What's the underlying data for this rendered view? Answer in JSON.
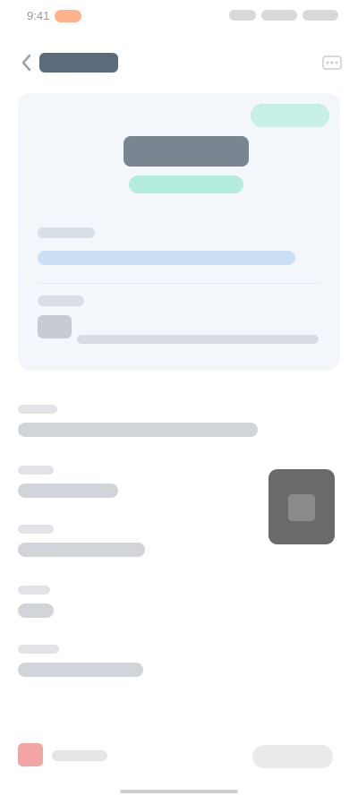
{
  "status_bar": {
    "time": "9:41",
    "icons": [
      "signal-icon",
      "wifi-icon",
      "battery-icon"
    ]
  },
  "nav": {
    "title": "",
    "back_icon": "chevron-left-icon",
    "more_icon": "more-icon"
  },
  "card": {
    "status": "",
    "amount": "",
    "amount_sub": "",
    "info": [
      {
        "label": "",
        "value": ""
      },
      {
        "label": "",
        "value": ""
      }
    ]
  },
  "details": [
    {
      "label": "",
      "value": ""
    },
    {
      "label": "",
      "value": ""
    },
    {
      "label": "",
      "value": ""
    },
    {
      "label": "",
      "value": ""
    },
    {
      "label": "",
      "value": ""
    }
  ],
  "bottom": {
    "left_label": "",
    "button_label": ""
  },
  "colors": {
    "card_bg": "#f3f7fb",
    "status_badge": "#c6efe7",
    "accent_teal": "#b5ece0",
    "accent_blue": "#cbe0f5",
    "bottom_icon": "#f2a5a5"
  }
}
